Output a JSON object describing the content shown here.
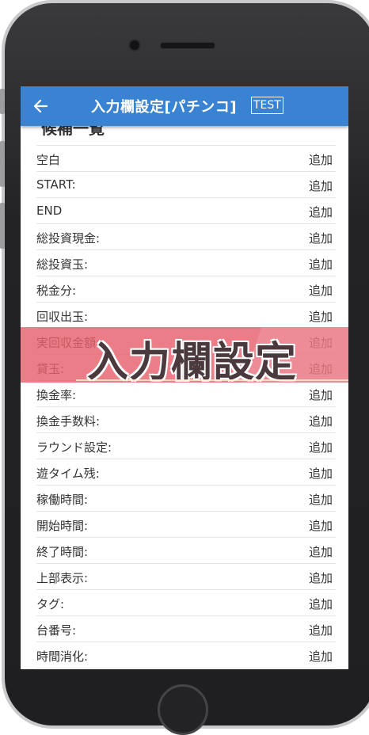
{
  "appbar": {
    "title": "入力欄設定[パチンコ]",
    "badge": "TEST",
    "back_icon": "arrow-left-icon"
  },
  "list": {
    "section_title": "候補一覧",
    "items": [
      {
        "label": "空白",
        "action": "追加"
      },
      {
        "label": "START:",
        "action": "追加"
      },
      {
        "label": "END",
        "action": "追加"
      },
      {
        "label": "総投資現金:",
        "action": "追加"
      },
      {
        "label": "総投資玉:",
        "action": "追加"
      },
      {
        "label": "税金分:",
        "action": "追加"
      },
      {
        "label": "回収出玉:",
        "action": "追加"
      },
      {
        "label": "実回収金額:",
        "action": "追加"
      },
      {
        "label": "貸玉:",
        "action": "追加"
      },
      {
        "label": "換金率:",
        "action": "追加"
      },
      {
        "label": "換金手数料:",
        "action": "追加"
      },
      {
        "label": "ラウンド設定:",
        "action": "追加"
      },
      {
        "label": "遊タイム残:",
        "action": "追加"
      },
      {
        "label": "稼働時間:",
        "action": "追加"
      },
      {
        "label": "開始時間:",
        "action": "追加"
      },
      {
        "label": "終了時間:",
        "action": "追加"
      },
      {
        "label": "上部表示:",
        "action": "追加"
      },
      {
        "label": "タグ:",
        "action": "追加"
      },
      {
        "label": "台番号:",
        "action": "追加"
      },
      {
        "label": "時間消化:",
        "action": "追加"
      }
    ]
  },
  "banner": {
    "title": "入力欄設定"
  },
  "colors": {
    "appbar": "#3a82d2",
    "banner": "#e7606e"
  }
}
